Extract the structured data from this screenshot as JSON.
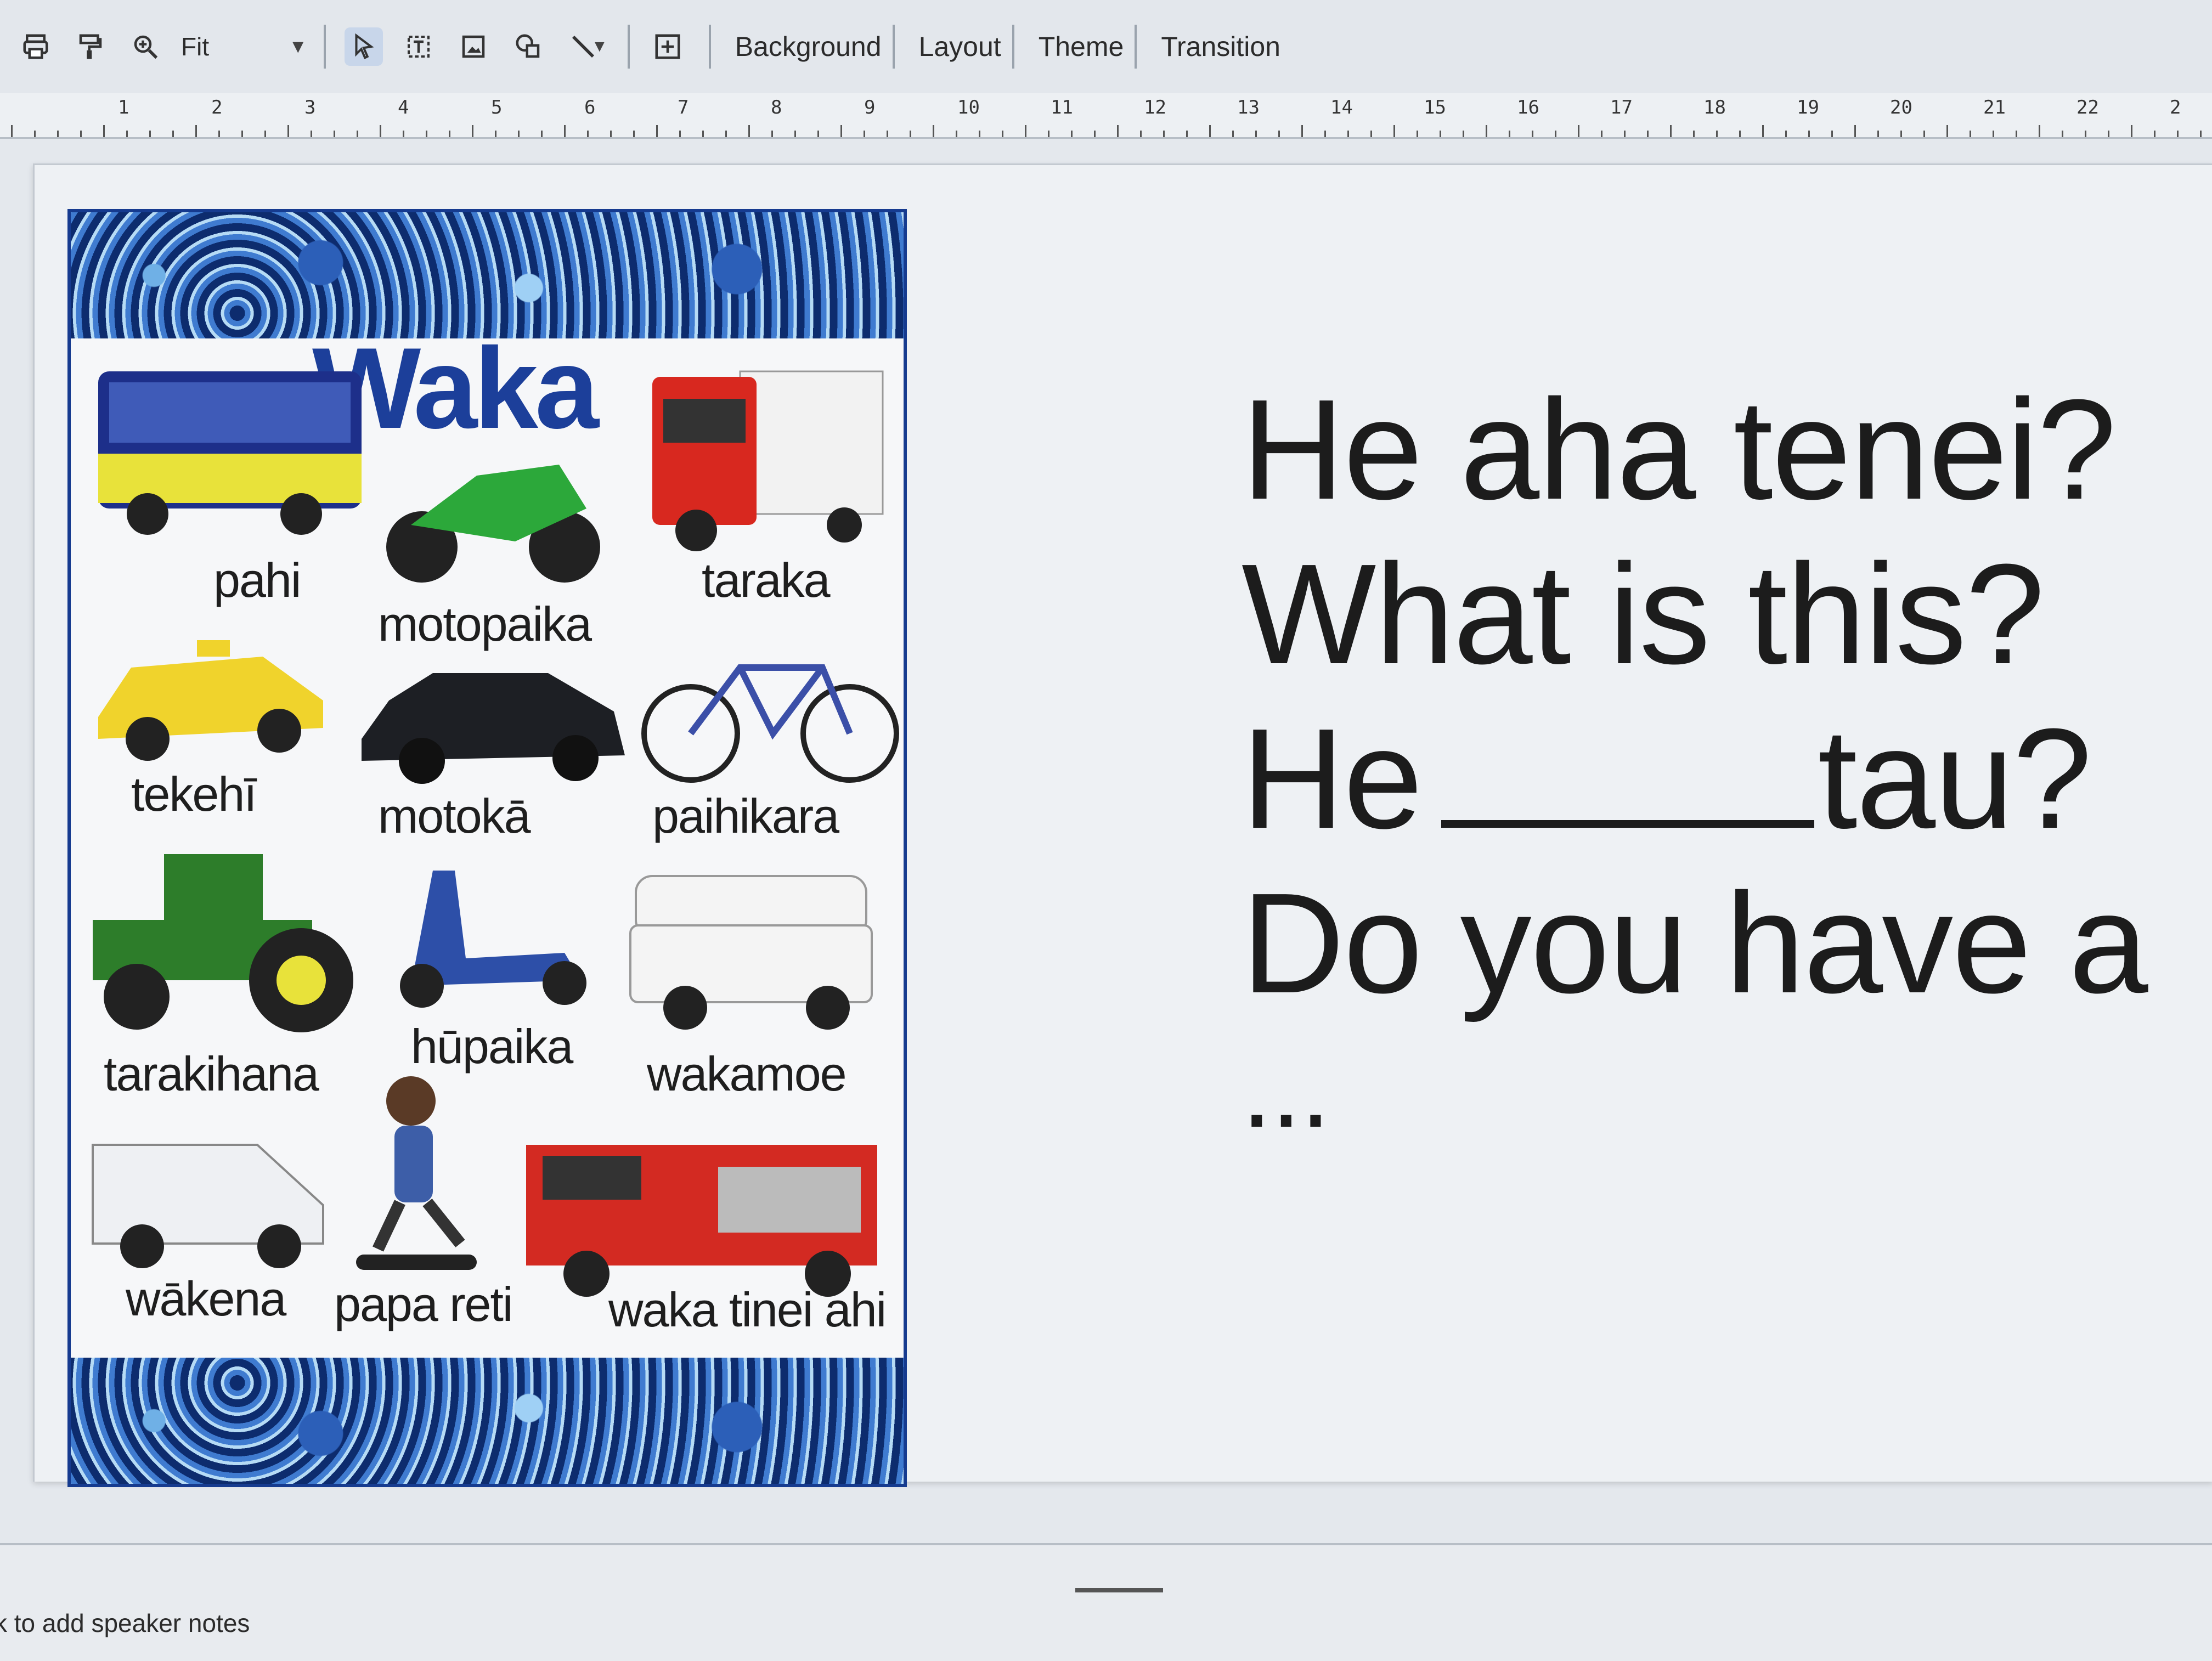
{
  "toolbar": {
    "zoom_value": "Fit",
    "buttons": {
      "background": "Background",
      "layout": "Layout",
      "theme": "Theme",
      "transition": "Transition"
    }
  },
  "ruler": {
    "marks": [
      "1",
      "2",
      "3",
      "4",
      "5",
      "6",
      "7",
      "8",
      "9",
      "10",
      "11",
      "12",
      "13",
      "14",
      "15",
      "16",
      "17",
      "18",
      "19",
      "20",
      "21",
      "22",
      "2"
    ]
  },
  "poster": {
    "title": "Waka",
    "vehicles": [
      {
        "label": "pahi",
        "icon": "bus-icon"
      },
      {
        "label": "motopaika",
        "icon": "motorbike-icon"
      },
      {
        "label": "taraka",
        "icon": "truck-icon"
      },
      {
        "label": "tekehī",
        "icon": "taxi-icon"
      },
      {
        "label": "motokā",
        "icon": "car-icon"
      },
      {
        "label": "paihikara",
        "icon": "bicycle-icon"
      },
      {
        "label": "tarakihana",
        "icon": "tractor-icon"
      },
      {
        "label": "hūpaika",
        "icon": "scooter-icon"
      },
      {
        "label": "wakamoe",
        "icon": "campervan-icon"
      },
      {
        "label": "wākena",
        "icon": "van-icon"
      },
      {
        "label": "papa reti",
        "icon": "skateboard-icon"
      },
      {
        "label": "waka tinei ahi",
        "icon": "firetruck-icon"
      }
    ]
  },
  "slide_text": {
    "line1": "He aha tenei?",
    "line2": "What is this?",
    "line3_start": "He",
    "line3_end": "tau?",
    "line4": "Do you have a",
    "line5": "..."
  },
  "notes": {
    "placeholder": "k to add speaker notes"
  }
}
